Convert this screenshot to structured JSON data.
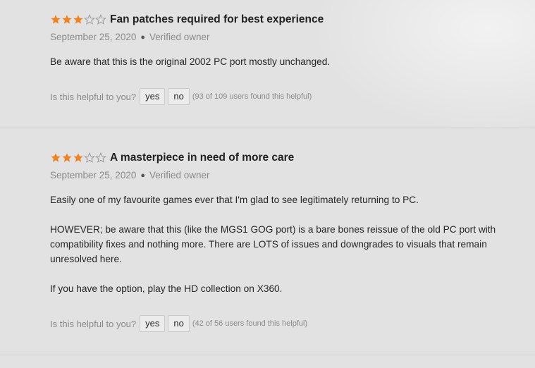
{
  "reviews": [
    {
      "rating": 3,
      "max_rating": 5,
      "title": "Fan patches required for best experience",
      "date": "September 25, 2020",
      "owner_label": "Verified owner",
      "paragraphs": [
        "Be aware that this is the original 2002 PC port mostly unchanged."
      ],
      "helpful": {
        "prompt": "Is this helpful to you?",
        "yes_label": "yes",
        "no_label": "no",
        "count_text": "(93 of 109 users found this helpful)"
      }
    },
    {
      "rating": 3,
      "max_rating": 5,
      "title": "A masterpiece in need of more care",
      "date": "September 25, 2020",
      "owner_label": "Verified owner",
      "paragraphs": [
        "Easily one of my favourite games ever that I'm glad to see legitimately returning to PC.",
        "HOWEVER; be aware that this (like the MGS1 GOG port) is a bare bones reissue of the old PC port with compatibility fixes and nothing more. There are LOTS of issues and downgrades to visuals that remain unresolved here.",
        "If you have the option, play the HD collection on X360."
      ],
      "helpful": {
        "prompt": "Is this helpful to you?",
        "yes_label": "yes",
        "no_label": "no",
        "count_text": "(42 of 56 users found this helpful)"
      }
    }
  ],
  "colors": {
    "star_filled": "#f0821e",
    "star_empty": "#9a9a9a",
    "background": "#e2e2e2"
  },
  "icons": {
    "star_filled": "star-filled-icon",
    "star_empty": "star-outline-icon"
  }
}
